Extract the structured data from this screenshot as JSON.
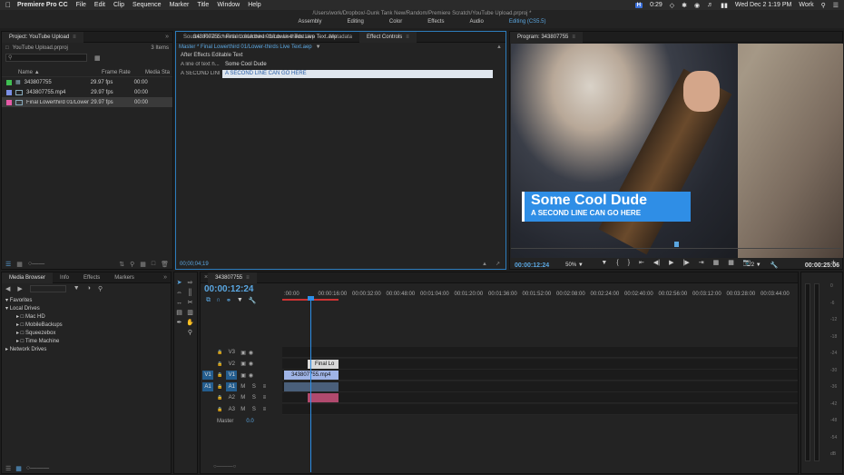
{
  "menubar": {
    "app": "Premiere Pro CC",
    "items": [
      "File",
      "Edit",
      "Clip",
      "Sequence",
      "Marker",
      "Title",
      "Window",
      "Help"
    ],
    "badge": "H",
    "time_remaining": "0:29",
    "clock": "Wed Dec 2  1:19 PM",
    "user": "Work"
  },
  "titlebar": {
    "path": "/Users/work/Dropbox/-Dunk Tank New/Random/Premiere Scratch/YouTube Upload.prproj *",
    "workspaces": [
      "Assembly",
      "Editing",
      "Color",
      "Effects",
      "Audio",
      "Editing (CS5.5)"
    ],
    "active_workspace": "Editing (CS5.5)"
  },
  "project": {
    "tab": "Project: YouTube Upload",
    "filename": "YouTube Upload.prproj",
    "count": "3 Items",
    "columns": {
      "name": "Name",
      "frame_rate": "Frame Rate",
      "media_start": "Media Sta"
    },
    "items": [
      {
        "name": "343807755",
        "frame_rate": "29.97 fps",
        "media_start": "00:00",
        "color": "#3fbf52"
      },
      {
        "name": "343807755.mp4",
        "frame_rate": "29.97 fps",
        "media_start": "00:00",
        "color": "#7a8fe6"
      },
      {
        "name": "Final Lowerthird 01/Lower",
        "frame_rate": "29.97 fps",
        "media_start": "00:00",
        "color": "#e65aa8"
      }
    ]
  },
  "effects": {
    "tabs": [
      "Source: Final Lowerthird 01/Lower-thirds Live Text.aep",
      "Metadata",
      "Effect Controls"
    ],
    "master": "Master * Final Lowerthird 01/Lower-thirds Live Text.aep",
    "clip": "343807755 * Final Lowerthird 01/Lower-thirds Live Text.aep",
    "header": "After Effects Editable Text",
    "params": [
      {
        "name": "A line of text h...",
        "value": "Some Cool Dude"
      },
      {
        "name": "A SECOND LINE...",
        "value": "A SECOND LINE CAN GO HERE"
      }
    ],
    "timecode": "00;00;04;19"
  },
  "program": {
    "tab": "Program: 343807755",
    "line1": "Some Cool Dude",
    "line2": "A SECOND LINE CAN GO HERE",
    "timecode": "00:00:12:24",
    "zoom": "50%",
    "resolution": "1/2",
    "duration": "00:00:25:06"
  },
  "media": {
    "tabs": [
      "Media Browser",
      "Info",
      "Effects",
      "Markers"
    ],
    "tree": [
      {
        "label": "Favorites",
        "level": 0
      },
      {
        "label": "Local Drives",
        "level": 0
      },
      {
        "label": "Mac HD",
        "level": 1
      },
      {
        "label": "MobileBackups",
        "level": 1
      },
      {
        "label": "Squeezebox",
        "level": 1
      },
      {
        "label": "Time Machine",
        "level": 1
      },
      {
        "label": "Network Drives",
        "level": 0
      }
    ]
  },
  "timeline": {
    "tab": "343807755",
    "timecode": "00:00:12:24",
    "ticks": [
      ":00:00",
      "00:00:16:00",
      "00:00:32:00",
      "00:00:48:00",
      "00:01:04:00",
      "00:01:20:00",
      "00:01:36:00",
      "00:01:52:00",
      "00:02:08:00",
      "00:02:24:00",
      "00:02:40:00",
      "00:02:56:00",
      "00:03:12:00",
      "00:03:28:00",
      "00:03:44:00"
    ],
    "tracks": [
      {
        "id": "V3",
        "src": "",
        "type": "video"
      },
      {
        "id": "V2",
        "src": "",
        "type": "video"
      },
      {
        "id": "V1",
        "src": "V1",
        "type": "video"
      },
      {
        "id": "A1",
        "src": "A1",
        "type": "audio"
      },
      {
        "id": "A2",
        "src": "",
        "type": "audio"
      },
      {
        "id": "A3",
        "src": "",
        "type": "audio"
      }
    ],
    "master": "Master",
    "master_value": "0.0",
    "clip_v2": "Final Lo",
    "clip_v1": "343807755.mp4"
  },
  "meter": {
    "scale": [
      "0",
      "-6",
      "-12",
      "-18",
      "-24",
      "-30",
      "-36",
      "-42",
      "-48",
      "-54",
      "dB"
    ]
  }
}
